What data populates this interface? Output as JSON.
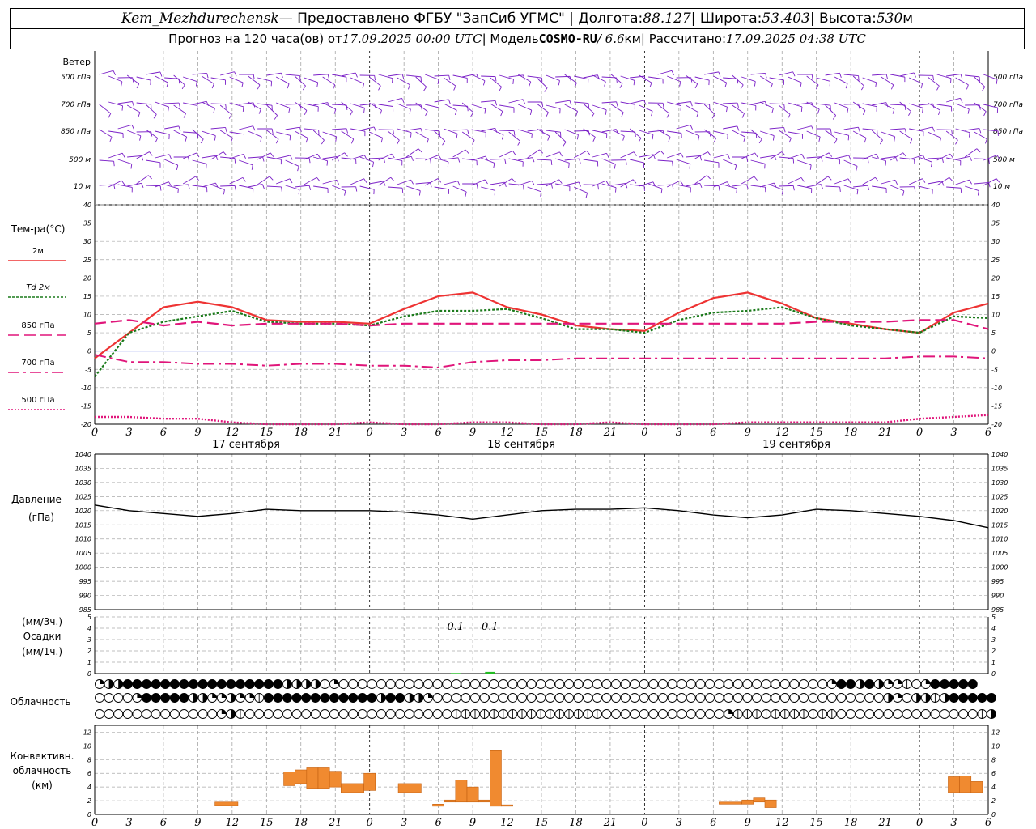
{
  "header": {
    "station": "Kem_Mezhdurechensk",
    "provider": " — Предоставлено ФГБУ \"ЗапСиб УГМС\" | Долгота: ",
    "lon": "88.127",
    "lat_label": " | Широта: ",
    "lat": "53.403",
    "alt_label": " | Высота: ",
    "alt": "530",
    "alt_unit": "м",
    "forecast_label": "Прогноз на 120 часа(ов) от ",
    "forecast_start": "17.09.2025 00:00 UTC",
    "model_label": " | Модель ",
    "model": "COSMO-RU",
    "resolution": " / 6.6",
    "res_unit": "км",
    "calc_label": " | Рассчитано: ",
    "calc_time": "17.09.2025 04:38 UTC"
  },
  "chart_data": {
    "x_hours": [
      0,
      3,
      6,
      9,
      12,
      15,
      18,
      21,
      0,
      3,
      6,
      9,
      12,
      15,
      18,
      21,
      0,
      3,
      6,
      9,
      12,
      15,
      18,
      21,
      0,
      3,
      6
    ],
    "day_labels": [
      "17 сентября",
      "18 сентября",
      "19 сентября"
    ],
    "wind": {
      "title": "Ветер",
      "levels": [
        "500 гПа",
        "700 гПа",
        "850 гПа",
        "500 м",
        "10  м"
      ],
      "color": "#7a1fc7"
    },
    "temperature": {
      "type": "line",
      "ylabel": "Тем-ра(°С)",
      "ylim": [
        -20,
        40
      ],
      "yticks": [
        -20,
        -15,
        -10,
        -5,
        0,
        5,
        10,
        15,
        20,
        25,
        30,
        35,
        40
      ],
      "legend": [
        "2м",
        "Td 2м",
        "850 гПа",
        "700 гПа",
        "500 гПа"
      ],
      "series": [
        {
          "name": "2м",
          "color": "#ee3333",
          "x": [
            0,
            3,
            6,
            9,
            12,
            15,
            18,
            21,
            24,
            27,
            30,
            33,
            36,
            39,
            42,
            45,
            48,
            51,
            54,
            57,
            60,
            63,
            66,
            69,
            72,
            75,
            78
          ],
          "values": [
            -2,
            5,
            12,
            13.5,
            12,
            8.5,
            8,
            8,
            7.5,
            11.5,
            15,
            16,
            12,
            10,
            7,
            6,
            5.5,
            10.5,
            14.5,
            16,
            13,
            9,
            7.5,
            6,
            5,
            10.5,
            13
          ]
        },
        {
          "name": "Td 2м",
          "color": "#1a7a1a",
          "x": [
            0,
            3,
            6,
            9,
            12,
            15,
            18,
            21,
            24,
            27,
            30,
            33,
            36,
            39,
            42,
            45,
            48,
            51,
            54,
            57,
            60,
            63,
            66,
            69,
            72,
            75,
            78
          ],
          "values": [
            -7,
            5,
            8,
            9.5,
            11,
            8,
            7.5,
            7.5,
            7,
            9.5,
            11,
            11,
            11.5,
            9,
            6,
            6,
            5,
            8.5,
            10.5,
            11,
            12,
            9,
            7,
            6,
            5,
            9.5,
            9
          ]
        },
        {
          "name": "850 гПа",
          "color": "#e0157a",
          "x": [
            0,
            3,
            6,
            9,
            12,
            15,
            18,
            21,
            24,
            27,
            30,
            33,
            36,
            39,
            42,
            45,
            48,
            51,
            54,
            57,
            60,
            63,
            66,
            69,
            72,
            75,
            78
          ],
          "values": [
            7.5,
            8.5,
            7,
            8,
            7,
            7.5,
            7.5,
            7.5,
            7,
            7.5,
            7.5,
            7.5,
            7.5,
            7.5,
            7.5,
            7.5,
            7.5,
            7.5,
            7.5,
            7.5,
            7.5,
            8,
            8,
            8,
            8.5,
            8.5,
            6
          ]
        },
        {
          "name": "700 гПа",
          "color": "#e0157a",
          "x": [
            0,
            3,
            6,
            9,
            12,
            15,
            18,
            21,
            24,
            27,
            30,
            33,
            36,
            39,
            42,
            45,
            48,
            51,
            54,
            57,
            60,
            63,
            66,
            69,
            72,
            75,
            78
          ],
          "values": [
            -1,
            -3,
            -3,
            -3.5,
            -3.5,
            -4,
            -3.5,
            -3.5,
            -4,
            -4,
            -4.5,
            -3,
            -2.5,
            -2.5,
            -2,
            -2,
            -2,
            -2,
            -2,
            -2,
            -2,
            -2,
            -2,
            -2,
            -1.5,
            -1.5,
            -2
          ]
        },
        {
          "name": "500 гПа",
          "color": "#e0157a",
          "x": [
            0,
            3,
            6,
            9,
            12,
            15,
            18,
            21,
            24,
            27,
            30,
            33,
            36,
            39,
            42,
            45,
            48,
            51,
            54,
            57,
            60,
            63,
            66,
            69,
            72,
            75,
            78
          ],
          "values": [
            -18,
            -18,
            -18.5,
            -18.5,
            -19.5,
            -20,
            -20,
            -20,
            -19.5,
            -20,
            -20,
            -19.5,
            -19.5,
            -20,
            -20,
            -19.5,
            -20,
            -20,
            -20,
            -19.5,
            -19.5,
            -19.5,
            -19.5,
            -19.5,
            -18.5,
            -18,
            -17.5
          ]
        }
      ]
    },
    "pressure": {
      "type": "line",
      "ylabel": "Давление",
      "yunit": "(гПа)",
      "ylim": [
        985,
        1040
      ],
      "yticks": [
        985,
        990,
        995,
        1000,
        1005,
        1010,
        1015,
        1020,
        1025,
        1030,
        1035,
        1040
      ],
      "series": [
        {
          "name": "",
          "color": "#000000",
          "x": [
            0,
            3,
            6,
            9,
            12,
            15,
            18,
            21,
            24,
            27,
            30,
            33,
            36,
            39,
            42,
            45,
            48,
            51,
            54,
            57,
            60,
            63,
            66,
            69,
            72,
            75,
            78
          ],
          "values": [
            1022,
            1020,
            1019,
            1018,
            1019,
            1020.5,
            1020,
            1020,
            1020,
            1019.5,
            1018.5,
            1017,
            1018.5,
            1020,
            1020.5,
            1020.5,
            1021,
            1020,
            1018.5,
            1017.5,
            1018.5,
            1020.5,
            1020,
            1019,
            1018,
            1016.5,
            1014
          ]
        }
      ]
    },
    "precipitation": {
      "type": "bar",
      "ylabel_top": "(мм/3ч.)",
      "ylabel_mid": "Осадки",
      "ylabel_bot": "(мм/1ч.)",
      "ylim": [
        0,
        5
      ],
      "yticks": [
        0,
        1,
        2,
        3,
        4,
        5
      ],
      "annotations": [
        {
          "x": 31.5,
          "text": "0.1"
        },
        {
          "x": 34.5,
          "text": "0.1"
        }
      ],
      "bars": [
        {
          "x": 31.5,
          "value": 0.05
        },
        {
          "x": 34.5,
          "value": 0.15
        }
      ],
      "color": "#22bb22"
    },
    "cloudiness": {
      "label": "Облачность",
      "rows": [
        [
          2,
          3,
          3,
          4,
          4,
          4,
          4,
          4,
          4,
          4,
          4,
          4,
          4,
          4,
          4,
          4,
          4,
          4,
          4,
          4,
          3,
          3,
          3,
          3,
          1,
          2,
          0,
          0,
          0,
          0,
          0,
          0,
          0,
          0,
          0,
          0,
          0,
          0,
          0,
          0,
          0,
          0,
          0,
          0,
          0,
          0,
          0,
          0,
          0,
          0,
          0,
          0,
          0,
          0,
          0,
          0,
          0,
          0,
          0,
          0,
          0,
          0,
          0,
          0,
          0,
          0,
          0,
          0,
          0,
          0,
          0,
          0,
          0,
          0,
          0,
          0,
          0,
          0,
          2,
          4,
          4,
          3,
          4,
          3,
          2,
          2,
          1,
          0,
          2,
          4,
          4,
          4,
          4,
          4
        ],
        [
          0,
          0,
          0,
          0,
          2,
          4,
          4,
          4,
          4,
          4,
          3,
          3,
          2,
          2,
          3,
          2,
          2,
          1,
          4,
          4,
          4,
          4,
          4,
          4,
          4,
          4,
          4,
          4,
          4,
          4,
          3,
          4,
          4,
          3,
          3,
          2,
          0,
          0,
          0,
          0,
          0,
          0,
          0,
          0,
          0,
          0,
          0,
          0,
          0,
          0,
          0,
          0,
          0,
          0,
          0,
          0,
          0,
          0,
          0,
          0,
          0,
          0,
          0,
          0,
          0,
          0,
          0,
          0,
          0,
          0,
          0,
          0,
          0,
          0,
          0,
          0,
          0,
          0,
          0,
          0,
          0,
          0,
          0,
          0,
          3,
          2,
          0,
          3,
          3,
          1,
          3,
          4,
          4,
          4,
          4,
          4
        ],
        [
          0,
          0,
          0,
          0,
          0,
          0,
          0,
          0,
          0,
          0,
          0,
          0,
          0,
          2,
          3,
          1,
          0,
          0,
          0,
          0,
          0,
          0,
          0,
          0,
          0,
          0,
          0,
          0,
          0,
          0,
          0,
          0,
          0,
          0,
          0,
          0,
          0,
          0,
          1,
          1,
          1,
          1,
          1,
          1,
          1,
          1,
          1,
          1,
          1,
          1,
          1,
          1,
          1,
          1,
          0,
          0,
          0,
          0,
          0,
          0,
          0,
          0,
          0,
          0,
          0,
          0,
          0,
          2,
          1,
          1,
          1,
          1,
          1,
          1,
          1,
          1,
          1,
          1,
          1,
          0,
          0,
          0,
          0,
          0,
          0,
          0,
          0,
          0,
          0,
          0,
          0,
          0,
          0,
          0,
          1,
          3
        ]
      ]
    },
    "convective": {
      "type": "bar",
      "ylabel": [
        "Конвективн.",
        "облачность",
        "(км)"
      ],
      "ylim": [
        0,
        13
      ],
      "yticks": [
        0,
        2,
        4,
        6,
        8,
        10,
        12
      ],
      "color": "#f08a30",
      "bars": [
        {
          "x0": 10.5,
          "x1": 12.5,
          "bottom": 1.3,
          "top": 1.8
        },
        {
          "x0": 16.5,
          "x1": 17.5,
          "bottom": 4.2,
          "top": 6.2
        },
        {
          "x0": 17.5,
          "x1": 18.5,
          "bottom": 4.5,
          "top": 6.5
        },
        {
          "x0": 18.5,
          "x1": 19.5,
          "bottom": 3.8,
          "top": 6.8
        },
        {
          "x0": 19.5,
          "x1": 20.5,
          "bottom": 3.8,
          "top": 6.8
        },
        {
          "x0": 20.5,
          "x1": 21.5,
          "bottom": 4.0,
          "top": 6.3
        },
        {
          "x0": 21.5,
          "x1": 23.5,
          "bottom": 3.2,
          "top": 4.5
        },
        {
          "x0": 23.5,
          "x1": 24.5,
          "bottom": 3.5,
          "top": 6.0
        },
        {
          "x0": 26.5,
          "x1": 28.5,
          "bottom": 3.2,
          "top": 4.5
        },
        {
          "x0": 29.5,
          "x1": 30.5,
          "bottom": 1.2,
          "top": 1.5
        },
        {
          "x0": 30.5,
          "x1": 31.5,
          "bottom": 1.8,
          "top": 2.1
        },
        {
          "x0": 31.5,
          "x1": 32.5,
          "bottom": 1.8,
          "top": 5.0
        },
        {
          "x0": 32.5,
          "x1": 33.5,
          "bottom": 1.8,
          "top": 4.0
        },
        {
          "x0": 33.5,
          "x1": 34.5,
          "bottom": 1.8,
          "top": 2.1
        },
        {
          "x0": 34.5,
          "x1": 35.5,
          "bottom": 1.2,
          "top": 9.3
        },
        {
          "x0": 35.5,
          "x1": 36.5,
          "bottom": 1.2,
          "top": 1.4
        },
        {
          "x0": 54.5,
          "x1": 56.5,
          "bottom": 1.5,
          "top": 1.8
        },
        {
          "x0": 56.5,
          "x1": 57.5,
          "bottom": 1.5,
          "top": 2.1
        },
        {
          "x0": 57.5,
          "x1": 58.5,
          "bottom": 1.8,
          "top": 2.4
        },
        {
          "x0": 58.5,
          "x1": 59.5,
          "bottom": 1.0,
          "top": 2.1
        },
        {
          "x0": 74.5,
          "x1": 75.5,
          "bottom": 3.2,
          "top": 5.5
        },
        {
          "x0": 75.5,
          "x1": 76.5,
          "bottom": 3.2,
          "top": 5.6
        },
        {
          "x0": 76.5,
          "x1": 77.5,
          "bottom": 3.2,
          "top": 4.8
        }
      ]
    }
  }
}
